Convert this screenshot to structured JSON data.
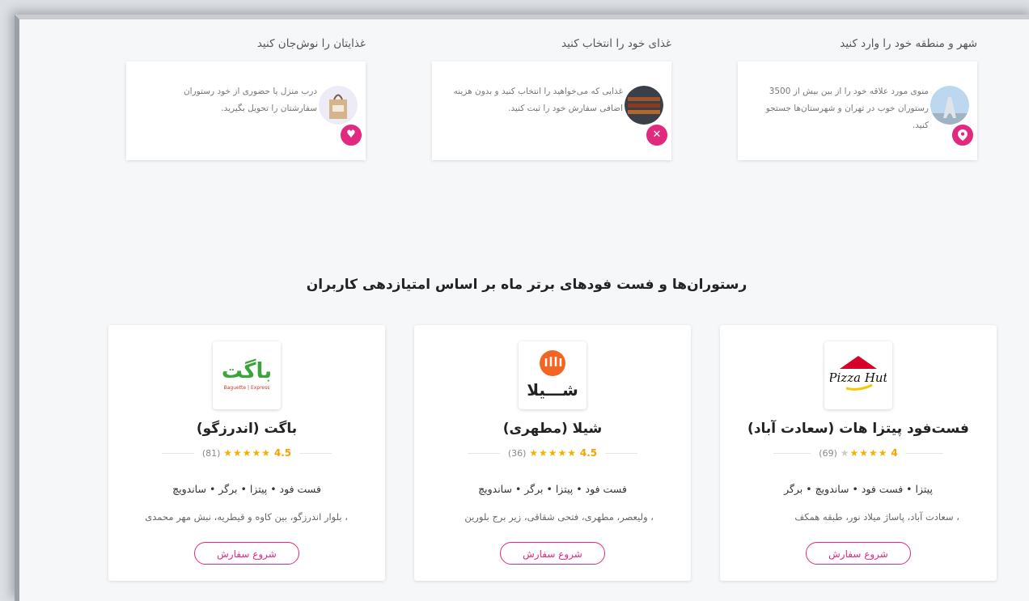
{
  "steps": [
    {
      "title": "شهر و منطقه خود را وارد کنید",
      "text": "منوی مورد علاقه خود را از بین بیش از 3500 رستوران خوب در تهران و شهرستان‌ها جستجو کنید.",
      "icon": "location-pin-icon"
    },
    {
      "title": "غذای خود را انتخاب کنید",
      "text": "غذایی که می‌خواهید را انتخاب کنید و بدون هزینه اضافی سفارش خود را ثبت کنید.",
      "icon": "fork-knife-icon"
    },
    {
      "title": "غذایتان را نوش‌جان کنید",
      "text": "درب منزل یا حضوری از خود رستوران سفارشتان را تحویل بگیرید.",
      "icon": "heart-icon"
    }
  ],
  "section_title": "رستوران‌ها و فست فودهای برتر ماه بر اساس امتیازدهی کاربران",
  "restaurants": [
    {
      "name": "فست‌فود پیتزا هات (سعادت آباد)",
      "score": "4",
      "rating": 4,
      "count": "(69)",
      "categories": "پیتزا • فست فود • ساندویچ • برگر",
      "address": "، سعادت آباد، پاساژ میلاد نور، طبقه همکف",
      "button": "شروع سفارش",
      "logo_text": "Pizza Hut"
    },
    {
      "name": "شیلا (مطهری)",
      "score": "4.5",
      "rating": 4.5,
      "count": "(36)",
      "categories": "فست فود • پیتزا • برگر • ساندویچ",
      "address": "، ولیعصر، مطهری، فتحی شقاقی، زیر برج بلورین",
      "button": "شروع سفارش",
      "logo_text": "شـــیلا"
    },
    {
      "name": "باگت (اندرزگو)",
      "score": "4.5",
      "rating": 4.5,
      "count": "(81)",
      "categories": "فست فود • پیتزا • برگر • ساندویچ",
      "address": "، بلوار اندرزگو، بین کاوه و قیطریه، نبش مهر محمدی",
      "button": "شروع سفارش",
      "logo_text": "باگت",
      "logo_sub": "Baguette | Express"
    }
  ],
  "colors": {
    "accent": "#e0297f",
    "star": "#f4b000"
  }
}
